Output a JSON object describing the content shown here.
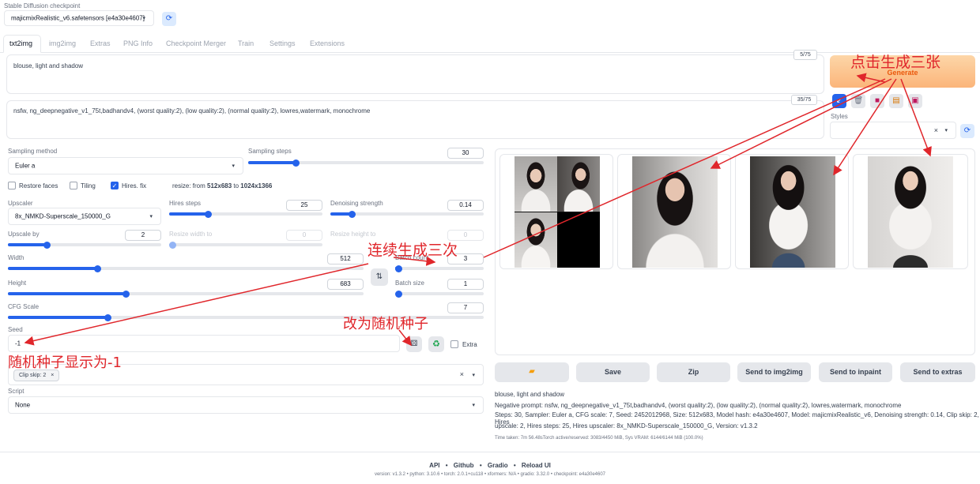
{
  "checkpoint": {
    "label": "Stable Diffusion checkpoint",
    "value": "majicmixRealistic_v6.safetensors [e4a30e4607]",
    "refresh_icon": "refresh-icon"
  },
  "tabs": [
    "txt2img",
    "img2img",
    "Extras",
    "PNG Info",
    "Checkpoint Merger",
    "Train",
    "Settings",
    "Extensions"
  ],
  "prompt": {
    "value": "blouse, light and shadow",
    "counter": "5/75"
  },
  "negative_prompt": {
    "value": "nsfw, ng_deepnegative_v1_75t,badhandv4, (worst quality:2), (low quality:2), (normal quality:2), lowres,watermark, monochrome",
    "counter": "35/75"
  },
  "generate": {
    "label": "Generate"
  },
  "styles": {
    "label": "Styles",
    "clear": "×",
    "caret": "▾"
  },
  "sampling": {
    "method_label": "Sampling method",
    "method_value": "Euler a",
    "steps_label": "Sampling steps",
    "steps_value": "30",
    "steps_fraction": 0.2
  },
  "options": {
    "restore_faces": "Restore faces",
    "tiling": "Tiling",
    "hires_fix": "Hires. fix",
    "resize_note_prefix": "resize: from ",
    "resize_from": "512x683",
    "resize_to_word": " to ",
    "resize_to": "1024x1366"
  },
  "hires": {
    "upscaler_label": "Upscaler",
    "upscaler_value": "8x_NMKD-Superscale_150000_G",
    "hires_steps_label": "Hires steps",
    "hires_steps_value": "25",
    "hires_steps_fraction": 0.25,
    "denoise_label": "Denoising strength",
    "denoise_value": "0.14",
    "denoise_fraction": 0.14,
    "upscale_by_label": "Upscale by",
    "upscale_by_value": "2",
    "upscale_by_fraction": 0.25,
    "resize_w_label": "Resize width to",
    "resize_w_value": "0",
    "resize_h_label": "Resize height to",
    "resize_h_value": "0"
  },
  "size": {
    "width_label": "Width",
    "width_value": "512",
    "width_fraction": 0.25,
    "height_label": "Height",
    "height_value": "683",
    "height_fraction": 0.33,
    "swap_icon": "⇅",
    "batch_count_label": "Batch count",
    "batch_count_value": "3",
    "batch_count_fraction": 0.02,
    "batch_size_label": "Batch size",
    "batch_size_value": "1",
    "batch_size_fraction": 0.0
  },
  "cfg": {
    "label": "CFG Scale",
    "value": "7",
    "fraction": 0.21
  },
  "seed": {
    "label": "Seed",
    "value": "-1",
    "extra_label": "Extra",
    "dice_icon": "dice-icon",
    "recycle_icon": "recycle-icon"
  },
  "clip_skip": {
    "tag": "Clip skip: 2",
    "tag_close": "×",
    "clear": "×",
    "caret": "▾"
  },
  "script": {
    "label": "Script",
    "value": "None"
  },
  "output_buttons": [
    "Save",
    "Zip",
    "Send to img2img",
    "Send to inpaint",
    "Send to extras"
  ],
  "info": {
    "prompt": "blouse, light and shadow",
    "negative": "Negative prompt: nsfw, ng_deepnegative_v1_75t,badhandv4, (worst quality:2), (low quality:2), (normal quality:2), lowres,watermark, monochrome",
    "params_1": "Steps: 30, Sampler: Euler a, CFG scale: 7, Seed: 2452012968, Size: 512x683, Model hash: e4a30e4607, Model: majicmixRealistic_v6, Denoising strength: 0.14, Clip skip: 2, Hires",
    "params_2": "upscale: 2, Hires steps: 25, Hires upscaler: 8x_NMKD-Superscale_150000_G, Version: v1.3.2",
    "time": "Time taken: 7m 56.48sTorch active/reserved: 3083/4450 MiB, Sys VRAM: 6144/6144 MiB (100.0%)"
  },
  "footer": {
    "links": [
      "API",
      "Github",
      "Gradio",
      "Reload UI"
    ],
    "sep": "•",
    "version_line": "version: v1.3.2  •  python: 3.10.6  •  torch: 2.0.1+cu118  •  xformers: N/A  •  gradio: 3.32.0  •  checkpoint: e4a30e4607"
  },
  "annotations": {
    "generate_three": "点击生成三张",
    "batch_three": "连续生成三次",
    "random_seed": "改为随机种子",
    "seed_shows": "随机种子显示为-1"
  },
  "colors": {
    "accent": "#2563eb",
    "generate_bg": "#fbb97a",
    "generate_text": "#ea580c",
    "annotation": "#e0262b"
  }
}
